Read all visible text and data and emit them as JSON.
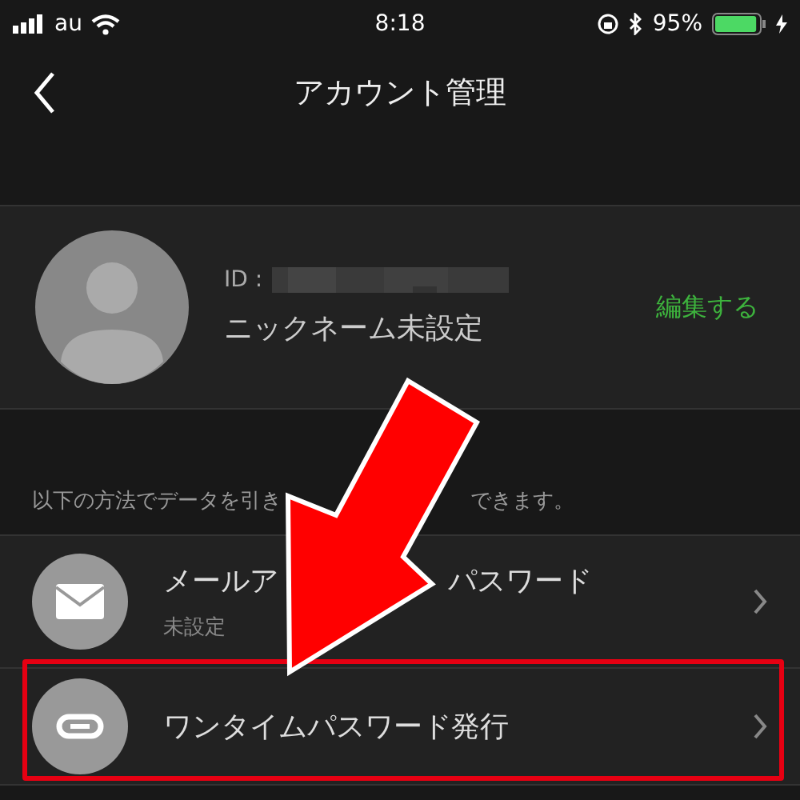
{
  "status_bar": {
    "carrier": "au",
    "time": "8:18",
    "battery": "95%"
  },
  "nav": {
    "title": "アカウント管理"
  },
  "profile": {
    "id_label": "ID :",
    "nickname": "ニックネーム未設定",
    "edit": "編集する"
  },
  "note": [
    "以下の方法でデータを引き",
    "できます。"
  ],
  "methods": [
    {
      "kind": "mail",
      "title_parts": [
        "メールア",
        "パスワード"
      ],
      "subtitle": "未設定",
      "highlighted": false
    },
    {
      "kind": "link",
      "title_parts": [
        "ワンタイムパスワード発行"
      ],
      "highlighted": true
    }
  ]
}
